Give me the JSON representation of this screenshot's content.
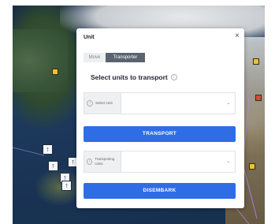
{
  "dialog": {
    "title": "Unit",
    "close_label": "×",
    "tabs": [
      {
        "label": "Move",
        "active": false
      },
      {
        "label": "Transporter",
        "active": true
      }
    ],
    "section_title": "Select units to transport",
    "fields": [
      {
        "label": "Select Unit",
        "value": ""
      },
      {
        "label": "Transporting Units",
        "value": ""
      }
    ],
    "transport_button": "TRANSPORT",
    "disembark_button": "DISEMBARK"
  },
  "map": {
    "unit_icons": [
      "arrow-up-icon",
      "arrow-up-icon",
      "arrow-up-icon",
      "arrow-up-icon",
      "arrow-up-icon"
    ]
  },
  "colors": {
    "primary": "#2f6de6",
    "active_tab": "#5a6470",
    "sea": "#1d3a5e"
  }
}
